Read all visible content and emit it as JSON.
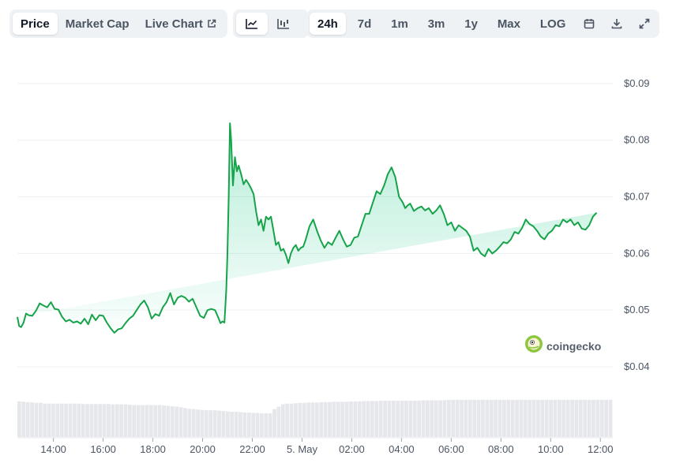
{
  "toolbar": {
    "metric_tabs": [
      "Price",
      "Market Cap",
      "Live Chart"
    ],
    "active_metric": "Price",
    "chart_style_buttons": [
      "line-chart-icon",
      "candlestick-chart-icon"
    ],
    "range_tabs": [
      "24h",
      "7d",
      "1m",
      "3m",
      "1y",
      "Max",
      "LOG"
    ],
    "active_range": "24h",
    "action_icons": [
      "calendar-icon",
      "download-icon",
      "expand-icon"
    ]
  },
  "watermark": {
    "text": "coingecko"
  },
  "colors": {
    "line": "#16a34a",
    "area": "#16c784",
    "volume": "#e5e7eb",
    "grid": "#eceff3"
  },
  "chart_data": {
    "type": "area",
    "y_ticks": [
      "$0.09",
      "$0.08",
      "$0.07",
      "$0.06",
      "$0.05",
      "$0.04"
    ],
    "ylim": [
      0.04,
      0.09
    ],
    "x_ticks": [
      "14:00",
      "16:00",
      "18:00",
      "20:00",
      "22:00",
      "5. May",
      "02:00",
      "04:00",
      "06:00",
      "08:00",
      "10:00",
      "12:00"
    ],
    "x_tick_hours": [
      14,
      16,
      18,
      20,
      22,
      24,
      26,
      28,
      30,
      32,
      34,
      36
    ],
    "xlim_hours": [
      12.55,
      36.5
    ],
    "grid": true,
    "series": [
      {
        "x_hours": [
          12.55,
          12.62,
          12.7,
          12.8,
          12.9,
          13.0,
          13.15,
          13.3,
          13.45,
          13.6,
          13.75,
          13.9,
          14.05,
          14.2,
          14.35,
          14.5,
          14.65,
          14.8,
          14.95,
          15.1,
          15.25,
          15.4,
          15.55,
          15.7,
          15.85,
          16.0,
          16.15,
          16.3,
          16.45,
          16.6,
          16.75,
          16.9,
          17.05,
          17.2,
          17.35,
          17.5,
          17.65,
          17.8,
          17.95,
          18.1,
          18.25,
          18.4,
          18.55,
          18.7,
          18.85,
          19.0,
          19.15,
          19.3,
          19.45,
          19.6,
          19.75,
          19.9,
          20.05,
          20.2,
          20.35,
          20.5,
          20.65,
          20.72,
          20.8,
          20.88,
          20.95,
          21.0,
          21.05,
          21.1,
          21.15,
          21.22,
          21.3,
          21.38,
          21.45,
          21.55,
          21.65,
          21.75,
          21.85,
          21.95,
          22.05,
          22.15,
          22.25,
          22.35,
          22.45,
          22.55,
          22.65,
          22.75,
          22.85,
          22.95,
          23.05,
          23.15,
          23.25,
          23.35,
          23.45,
          23.55,
          23.65,
          23.75,
          23.85,
          23.95,
          24.05,
          24.15,
          24.3,
          24.45,
          24.6,
          24.75,
          24.9,
          25.05,
          25.2,
          25.35,
          25.5,
          25.65,
          25.8,
          25.95,
          26.1,
          26.25,
          26.4,
          26.55,
          26.7,
          26.85,
          27.0,
          27.15,
          27.3,
          27.45,
          27.6,
          27.75,
          27.9,
          28.05,
          28.15,
          28.25,
          28.35,
          28.5,
          28.65,
          28.8,
          28.95,
          29.1,
          29.25,
          29.4,
          29.55,
          29.7,
          29.85,
          30.0,
          30.15,
          30.3,
          30.45,
          30.6,
          30.75,
          30.9,
          31.05,
          31.2,
          31.35,
          31.5,
          31.65,
          31.8,
          31.95,
          32.1,
          32.25,
          32.4,
          32.55,
          32.7,
          32.85,
          33.0,
          33.15,
          33.3,
          33.45,
          33.6,
          33.75,
          33.9,
          34.05,
          34.2,
          34.35,
          34.5,
          34.65,
          34.8,
          34.95,
          35.1,
          35.25,
          35.4,
          35.55,
          35.7,
          35.85,
          36.0,
          36.15,
          36.3,
          36.45
        ],
        "values": [
          0.0488,
          0.0472,
          0.047,
          0.0478,
          0.0494,
          0.0491,
          0.049,
          0.0499,
          0.0512,
          0.0508,
          0.0505,
          0.0514,
          0.0502,
          0.0501,
          0.0488,
          0.048,
          0.0483,
          0.0478,
          0.048,
          0.0476,
          0.0485,
          0.0475,
          0.0492,
          0.0482,
          0.0491,
          0.049,
          0.0478,
          0.0468,
          0.046,
          0.0466,
          0.0468,
          0.0477,
          0.0485,
          0.049,
          0.05,
          0.051,
          0.0517,
          0.0505,
          0.0485,
          0.0493,
          0.049,
          0.0505,
          0.0514,
          0.053,
          0.051,
          0.0522,
          0.0525,
          0.0522,
          0.0515,
          0.052,
          0.0505,
          0.049,
          0.0486,
          0.05,
          0.0502,
          0.05,
          0.0485,
          0.0477,
          0.048,
          0.0478,
          0.0535,
          0.06,
          0.07,
          0.083,
          0.08,
          0.072,
          0.077,
          0.0745,
          0.0755,
          0.074,
          0.0722,
          0.073,
          0.0723,
          0.0715,
          0.0705,
          0.0675,
          0.065,
          0.066,
          0.064,
          0.0665,
          0.066,
          0.0665,
          0.064,
          0.0615,
          0.062,
          0.0605,
          0.0608,
          0.0598,
          0.0583,
          0.06,
          0.061,
          0.0615,
          0.0605,
          0.061,
          0.0612,
          0.0625,
          0.0648,
          0.066,
          0.064,
          0.0623,
          0.061,
          0.062,
          0.0615,
          0.0628,
          0.064,
          0.0625,
          0.0612,
          0.0615,
          0.0628,
          0.063,
          0.065,
          0.067,
          0.067,
          0.069,
          0.071,
          0.0705,
          0.072,
          0.074,
          0.0752,
          0.0735,
          0.07,
          0.069,
          0.068,
          0.0685,
          0.0688,
          0.0675,
          0.068,
          0.0683,
          0.0676,
          0.068,
          0.067,
          0.0676,
          0.0685,
          0.067,
          0.065,
          0.0655,
          0.064,
          0.065,
          0.0645,
          0.064,
          0.063,
          0.0605,
          0.061,
          0.06,
          0.0595,
          0.0608,
          0.06,
          0.0605,
          0.0612,
          0.062,
          0.0618,
          0.0625,
          0.0638,
          0.0635,
          0.0645,
          0.066,
          0.0652,
          0.0648,
          0.064,
          0.063,
          0.0625,
          0.0635,
          0.064,
          0.065,
          0.0648,
          0.066,
          0.0655,
          0.066,
          0.065,
          0.0655,
          0.0644,
          0.0642,
          0.065,
          0.0665,
          0.0672
        ]
      }
    ],
    "volume_shape": [
      0.96,
      0.95,
      0.94,
      0.93,
      0.92,
      0.92,
      0.9,
      0.9,
      0.9,
      0.9,
      0.9,
      0.9,
      0.9,
      0.9,
      0.9,
      0.89,
      0.89,
      0.89,
      0.89,
      0.89,
      0.89,
      0.89,
      0.88,
      0.88,
      0.88,
      0.88,
      0.87,
      0.86,
      0.86,
      0.86,
      0.86,
      0.86,
      0.86,
      0.86,
      0.85,
      0.84,
      0.83,
      0.82,
      0.8,
      0.78,
      0.76,
      0.75,
      0.74,
      0.73,
      0.72,
      0.72,
      0.72,
      0.71,
      0.7,
      0.69,
      0.68,
      0.68,
      0.67,
      0.66,
      0.66,
      0.65,
      0.65,
      0.64,
      0.64,
      0.64,
      0.75,
      0.82,
      0.88,
      0.9,
      0.9,
      0.91,
      0.92,
      0.92,
      0.93,
      0.93,
      0.93,
      0.94,
      0.94,
      0.94,
      0.95,
      0.95,
      0.95,
      0.95,
      0.96,
      0.96,
      0.96,
      0.97,
      0.97,
      0.97,
      0.97,
      0.98,
      0.98,
      0.98,
      0.98,
      0.98,
      0.98,
      0.98,
      0.98,
      0.98,
      0.98,
      0.99,
      0.99,
      0.99,
      0.99,
      0.99,
      0.99,
      1.0,
      1.0,
      1.0,
      1.0,
      1.0,
      1.0,
      1.0,
      1.0,
      1.0,
      1.0,
      1.0,
      1.0,
      1.0,
      1.0,
      1.0,
      1.0,
      1.0,
      1.0,
      1.0,
      1.0,
      1.0,
      1.0,
      1.0,
      1.0,
      1.0,
      1.0,
      1.0,
      1.0,
      1.0,
      1.0,
      1.0,
      1.0,
      1.0,
      1.0,
      1.0,
      1.0,
      1.0,
      1.0,
      1.0
    ]
  }
}
